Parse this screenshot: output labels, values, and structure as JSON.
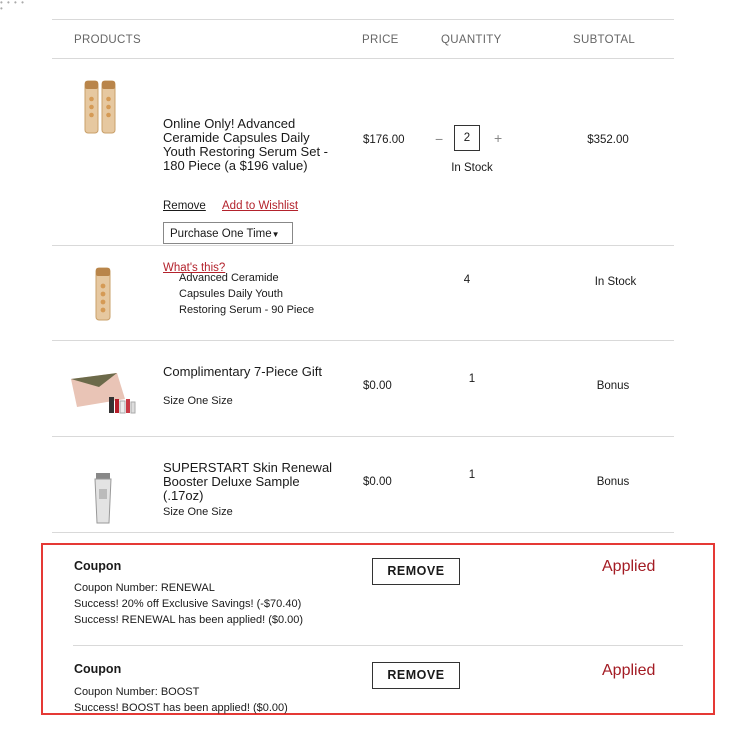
{
  "header": {
    "products": "PRODUCTS",
    "price": "PRICE",
    "quantity": "QUANTITY",
    "subtotal": "SUBTOTAL"
  },
  "items": [
    {
      "name": "Online Only! Advanced Ceramide Capsules Daily Youth Restoring Serum Set - 180 Piece (a $196 value)",
      "price": "$176.00",
      "quantity": "2",
      "stock": "In Stock",
      "subtotal": "$352.00",
      "remove": "Remove",
      "wishlist": "Add to Wishlist",
      "purchase_option": "Purchase One Time",
      "whats_this": "What's this?",
      "minus": "−",
      "plus": "+"
    },
    {
      "name": "Advanced Ceramide Capsules Daily Youth Restoring Serum - 90 Piece",
      "quantity": "4",
      "subtotal": "In Stock"
    },
    {
      "name": "Complimentary 7-Piece Gift",
      "size": "Size One Size",
      "price": "$0.00",
      "quantity": "1",
      "subtotal": "Bonus"
    },
    {
      "name": "SUPERSTART Skin Renewal Booster Deluxe Sample (.17oz)",
      "size": "Size One Size",
      "price": "$0.00",
      "quantity": "1",
      "subtotal": "Bonus"
    }
  ],
  "coupons": [
    {
      "title": "Coupon",
      "number": "Coupon Number: RENEWAL",
      "lines": [
        "Success! 20% off Exclusive Savings! (-$70.40)",
        "Success! RENEWAL has been applied! ($0.00)"
      ],
      "button": "REMOVE",
      "status": "Applied"
    },
    {
      "title": "Coupon",
      "number": "Coupon Number: BOOST",
      "lines": [
        "Success! BOOST has been applied! ($0.00)"
      ],
      "button": "REMOVE",
      "status": "Applied"
    }
  ],
  "colors": {
    "accent_red": "#a31b23",
    "highlight_border": "#e53935",
    "link_red": "#b3222c"
  }
}
